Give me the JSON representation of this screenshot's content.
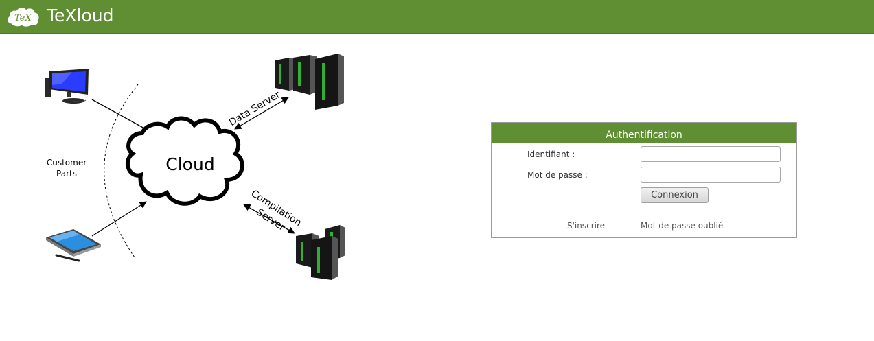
{
  "header": {
    "title": "TeXloud",
    "logo_text": "TeX"
  },
  "diagram": {
    "cloud_label": "Cloud",
    "customer_label_line1": "Customer",
    "customer_label_line2": "Parts",
    "data_server_label": "Data Server",
    "compilation_label_line1": "Compilation",
    "compilation_label_line2": "Server"
  },
  "auth": {
    "title": "Authentification",
    "identifiant_label": "Identifiant :",
    "identifiant_value": "",
    "password_label": "Mot de passe :",
    "password_value": "",
    "login_button": "Connexion",
    "register_link": "S'inscrire",
    "forgot_link": "Mot de passe oublié"
  },
  "colors": {
    "brand_green": "#5f8f32",
    "server_led_green": "#3ee03e"
  }
}
